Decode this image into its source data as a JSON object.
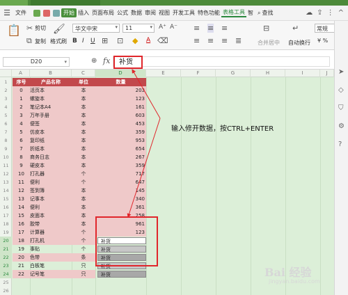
{
  "menu": {
    "file": "文件",
    "items": [
      "开始",
      "插入",
      "页面布局",
      "公式",
      "数据",
      "审阅",
      "视图",
      "开发工具",
      "特色功能",
      "表格工具",
      "智"
    ],
    "search": "查找"
  },
  "ribbon": {
    "cut": "剪切",
    "paste_icon": "paste-icon",
    "copy": "复制",
    "format_painter": "格式刷",
    "font": "华文中宋",
    "font_size": "11",
    "merge_center": "合并居中",
    "wrap": "自动换行",
    "number_format": "常规"
  },
  "formula_bar": {
    "name_box": "D20",
    "fx": "fx",
    "value": "补货"
  },
  "columns": [
    "A",
    "B",
    "C",
    "D",
    "E",
    "F",
    "G",
    "H",
    "I",
    "J"
  ],
  "rows": [
    "1",
    "2",
    "3",
    "4",
    "5",
    "6",
    "7",
    "8",
    "9",
    "10",
    "11",
    "12",
    "13",
    "14",
    "15",
    "16",
    "17",
    "18",
    "19",
    "20",
    "21",
    "22",
    "23",
    "24",
    "25",
    "26"
  ],
  "table": {
    "headers": [
      "序号",
      "产品名称",
      "单位",
      "数量"
    ],
    "rows": [
      [
        "0",
        "活页本",
        "本",
        "203"
      ],
      [
        "1",
        "螺旋本",
        "本",
        "123"
      ],
      [
        "2",
        "笔记本A4",
        "本",
        "161"
      ],
      [
        "3",
        "万年手册",
        "本",
        "603"
      ],
      [
        "4",
        "便签",
        "本",
        "453"
      ],
      [
        "5",
        "仿皮本",
        "本",
        "359"
      ],
      [
        "6",
        "复印纸",
        "本",
        "953"
      ],
      [
        "7",
        "折纸本",
        "本",
        "654"
      ],
      [
        "8",
        "商务日志",
        "本",
        "267"
      ],
      [
        "9",
        "硬皮本",
        "本",
        "359"
      ],
      [
        "10",
        "打孔器",
        "个",
        "717"
      ],
      [
        "11",
        "便利",
        "个",
        "647"
      ],
      [
        "12",
        "签到簿",
        "本",
        "145"
      ],
      [
        "13",
        "记事本",
        "本",
        "340"
      ],
      [
        "14",
        "便利",
        "本",
        "361"
      ],
      [
        "15",
        "皮面本",
        "本",
        "258"
      ],
      [
        "16",
        "胶带",
        "本",
        "961"
      ],
      [
        "17",
        "计算器",
        "个",
        "123"
      ],
      [
        "18",
        "打孔机",
        "个",
        "补货"
      ],
      [
        "19",
        "事贴",
        "个",
        "补货"
      ],
      [
        "20",
        "色带",
        "条",
        "补货"
      ],
      [
        "21",
        "白板笔",
        "只",
        "补货"
      ],
      [
        "22",
        "记号笔",
        "只",
        "补货"
      ]
    ]
  },
  "annotation": "输入修开数据，按CTRL+ENTER",
  "watermark": "Bai 经验",
  "watermark_url": "jingyan.baidu.com",
  "colors": {
    "header_fill": "#c2484c",
    "row_fill": "#efc9c9",
    "sheet_bg": "#dcefd8",
    "highlight": "#e0262b",
    "accent": "#2b8a3e"
  }
}
